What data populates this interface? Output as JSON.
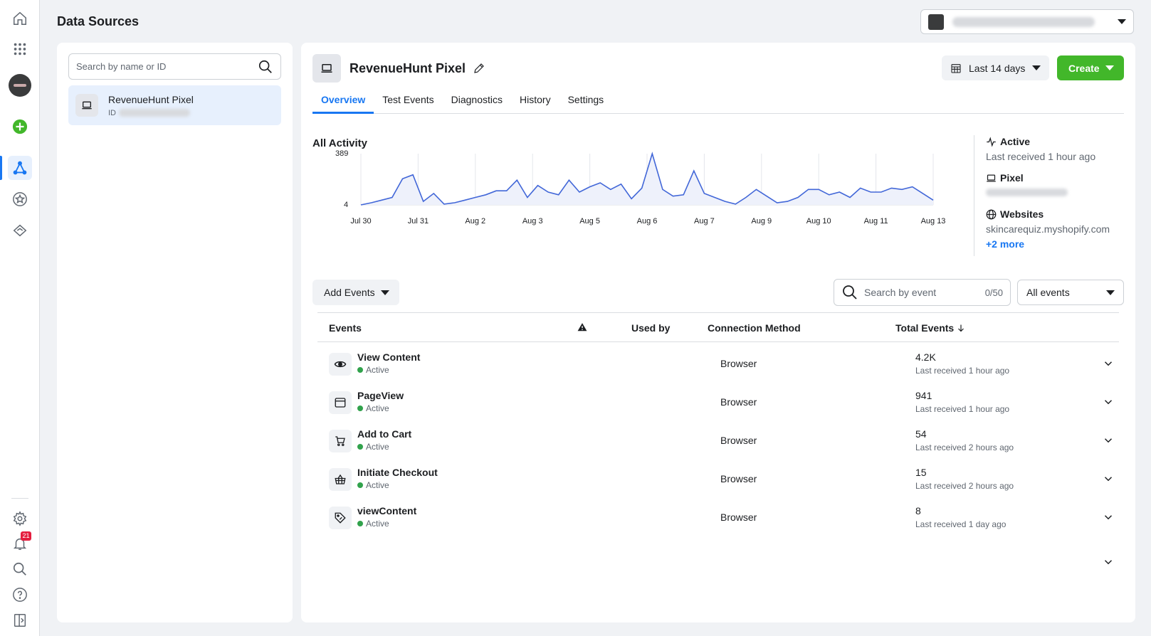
{
  "header": {
    "title": "Data Sources"
  },
  "rail": {
    "notification_count": "21"
  },
  "sidebar": {
    "search_placeholder": "Search by name or ID",
    "sources": [
      {
        "name": "RevenueHunt Pixel",
        "id_label": "ID"
      }
    ]
  },
  "pixel": {
    "name": "RevenueHunt Pixel",
    "date_range": "Last 14 days",
    "create_label": "Create",
    "tabs": [
      "Overview",
      "Test Events",
      "Diagnostics",
      "History",
      "Settings"
    ]
  },
  "activity": {
    "title": "All Activity",
    "status": "Active",
    "last_received": "Last received 1 hour ago",
    "type_label": "Pixel",
    "websites_label": "Websites",
    "website": "skincarequiz.myshopify.com",
    "more": "+2 more"
  },
  "chart_data": {
    "type": "area",
    "title": "All Activity",
    "ylim": [
      4,
      389
    ],
    "y_ticks": [
      "389",
      "4"
    ],
    "x_tick_labels": [
      "Jul 30",
      "Jul 31",
      "Aug 2",
      "Aug 3",
      "Aug 5",
      "Aug 6",
      "Aug 7",
      "Aug 9",
      "Aug 10",
      "Aug 11",
      "Aug 13"
    ],
    "values": [
      4,
      20,
      40,
      60,
      200,
      230,
      30,
      90,
      10,
      20,
      40,
      60,
      80,
      110,
      110,
      190,
      60,
      150,
      100,
      80,
      190,
      100,
      140,
      170,
      120,
      160,
      50,
      130,
      389,
      120,
      70,
      80,
      260,
      90,
      60,
      30,
      10,
      60,
      120,
      70,
      20,
      30,
      60,
      120,
      120,
      80,
      100,
      60,
      130,
      100,
      100,
      130,
      120,
      140,
      90,
      40
    ],
    "series_color": "#4267d8",
    "fill_color": "#eef1fb"
  },
  "events_table": {
    "add_events_label": "Add Events",
    "search_placeholder": "Search by event",
    "count": "0/50",
    "filter": "All events",
    "columns": [
      "Events",
      "Used by",
      "Connection Method",
      "Total Events"
    ],
    "rows": [
      {
        "name": "View Content",
        "status": "Active",
        "connection": "Browser",
        "total": "4.2K",
        "last": "Last received 1 hour ago",
        "icon": "eye-icon"
      },
      {
        "name": "PageView",
        "status": "Active",
        "connection": "Browser",
        "total": "941",
        "last": "Last received 1 hour ago",
        "icon": "browser-window-icon"
      },
      {
        "name": "Add to Cart",
        "status": "Active",
        "connection": "Browser",
        "total": "54",
        "last": "Last received 2 hours ago",
        "icon": "cart-icon"
      },
      {
        "name": "Initiate Checkout",
        "status": "Active",
        "connection": "Browser",
        "total": "15",
        "last": "Last received 2 hours ago",
        "icon": "basket-icon"
      },
      {
        "name": "viewContent",
        "status": "Active",
        "connection": "Browser",
        "total": "8",
        "last": "Last received 1 day ago",
        "icon": "tag-icon"
      }
    ]
  }
}
